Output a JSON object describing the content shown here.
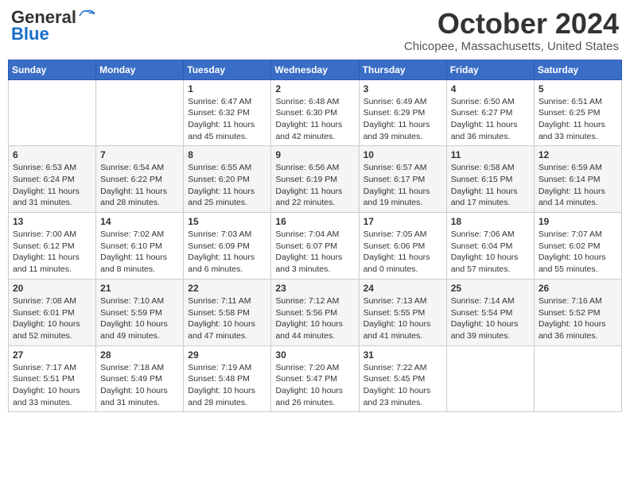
{
  "header": {
    "logo_line1": "General",
    "logo_line2": "Blue",
    "month": "October 2024",
    "location": "Chicopee, Massachusetts, United States"
  },
  "weekdays": [
    "Sunday",
    "Monday",
    "Tuesday",
    "Wednesday",
    "Thursday",
    "Friday",
    "Saturday"
  ],
  "weeks": [
    [
      {
        "day": "",
        "info": ""
      },
      {
        "day": "",
        "info": ""
      },
      {
        "day": "1",
        "info": "Sunrise: 6:47 AM\nSunset: 6:32 PM\nDaylight: 11 hours and 45 minutes."
      },
      {
        "day": "2",
        "info": "Sunrise: 6:48 AM\nSunset: 6:30 PM\nDaylight: 11 hours and 42 minutes."
      },
      {
        "day": "3",
        "info": "Sunrise: 6:49 AM\nSunset: 6:29 PM\nDaylight: 11 hours and 39 minutes."
      },
      {
        "day": "4",
        "info": "Sunrise: 6:50 AM\nSunset: 6:27 PM\nDaylight: 11 hours and 36 minutes."
      },
      {
        "day": "5",
        "info": "Sunrise: 6:51 AM\nSunset: 6:25 PM\nDaylight: 11 hours and 33 minutes."
      }
    ],
    [
      {
        "day": "6",
        "info": "Sunrise: 6:53 AM\nSunset: 6:24 PM\nDaylight: 11 hours and 31 minutes."
      },
      {
        "day": "7",
        "info": "Sunrise: 6:54 AM\nSunset: 6:22 PM\nDaylight: 11 hours and 28 minutes."
      },
      {
        "day": "8",
        "info": "Sunrise: 6:55 AM\nSunset: 6:20 PM\nDaylight: 11 hours and 25 minutes."
      },
      {
        "day": "9",
        "info": "Sunrise: 6:56 AM\nSunset: 6:19 PM\nDaylight: 11 hours and 22 minutes."
      },
      {
        "day": "10",
        "info": "Sunrise: 6:57 AM\nSunset: 6:17 PM\nDaylight: 11 hours and 19 minutes."
      },
      {
        "day": "11",
        "info": "Sunrise: 6:58 AM\nSunset: 6:15 PM\nDaylight: 11 hours and 17 minutes."
      },
      {
        "day": "12",
        "info": "Sunrise: 6:59 AM\nSunset: 6:14 PM\nDaylight: 11 hours and 14 minutes."
      }
    ],
    [
      {
        "day": "13",
        "info": "Sunrise: 7:00 AM\nSunset: 6:12 PM\nDaylight: 11 hours and 11 minutes."
      },
      {
        "day": "14",
        "info": "Sunrise: 7:02 AM\nSunset: 6:10 PM\nDaylight: 11 hours and 8 minutes."
      },
      {
        "day": "15",
        "info": "Sunrise: 7:03 AM\nSunset: 6:09 PM\nDaylight: 11 hours and 6 minutes."
      },
      {
        "day": "16",
        "info": "Sunrise: 7:04 AM\nSunset: 6:07 PM\nDaylight: 11 hours and 3 minutes."
      },
      {
        "day": "17",
        "info": "Sunrise: 7:05 AM\nSunset: 6:06 PM\nDaylight: 11 hours and 0 minutes."
      },
      {
        "day": "18",
        "info": "Sunrise: 7:06 AM\nSunset: 6:04 PM\nDaylight: 10 hours and 57 minutes."
      },
      {
        "day": "19",
        "info": "Sunrise: 7:07 AM\nSunset: 6:02 PM\nDaylight: 10 hours and 55 minutes."
      }
    ],
    [
      {
        "day": "20",
        "info": "Sunrise: 7:08 AM\nSunset: 6:01 PM\nDaylight: 10 hours and 52 minutes."
      },
      {
        "day": "21",
        "info": "Sunrise: 7:10 AM\nSunset: 5:59 PM\nDaylight: 10 hours and 49 minutes."
      },
      {
        "day": "22",
        "info": "Sunrise: 7:11 AM\nSunset: 5:58 PM\nDaylight: 10 hours and 47 minutes."
      },
      {
        "day": "23",
        "info": "Sunrise: 7:12 AM\nSunset: 5:56 PM\nDaylight: 10 hours and 44 minutes."
      },
      {
        "day": "24",
        "info": "Sunrise: 7:13 AM\nSunset: 5:55 PM\nDaylight: 10 hours and 41 minutes."
      },
      {
        "day": "25",
        "info": "Sunrise: 7:14 AM\nSunset: 5:54 PM\nDaylight: 10 hours and 39 minutes."
      },
      {
        "day": "26",
        "info": "Sunrise: 7:16 AM\nSunset: 5:52 PM\nDaylight: 10 hours and 36 minutes."
      }
    ],
    [
      {
        "day": "27",
        "info": "Sunrise: 7:17 AM\nSunset: 5:51 PM\nDaylight: 10 hours and 33 minutes."
      },
      {
        "day": "28",
        "info": "Sunrise: 7:18 AM\nSunset: 5:49 PM\nDaylight: 10 hours and 31 minutes."
      },
      {
        "day": "29",
        "info": "Sunrise: 7:19 AM\nSunset: 5:48 PM\nDaylight: 10 hours and 28 minutes."
      },
      {
        "day": "30",
        "info": "Sunrise: 7:20 AM\nSunset: 5:47 PM\nDaylight: 10 hours and 26 minutes."
      },
      {
        "day": "31",
        "info": "Sunrise: 7:22 AM\nSunset: 5:45 PM\nDaylight: 10 hours and 23 minutes."
      },
      {
        "day": "",
        "info": ""
      },
      {
        "day": "",
        "info": ""
      }
    ]
  ]
}
